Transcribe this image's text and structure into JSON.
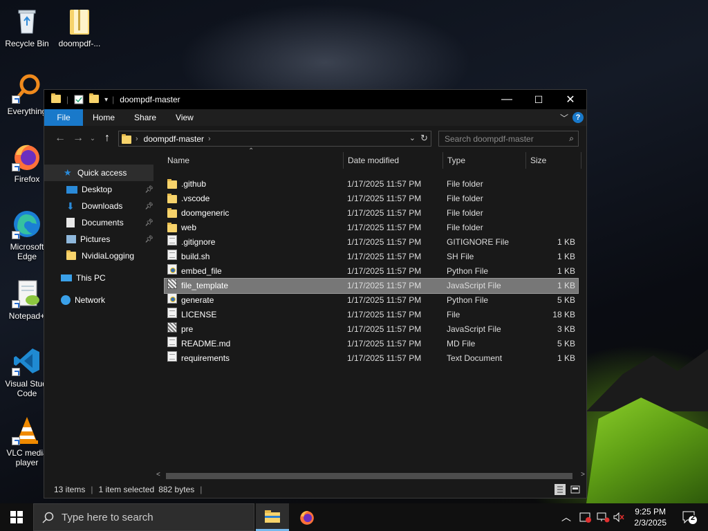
{
  "desktop": {
    "icons": [
      {
        "label": "Recycle Bin"
      },
      {
        "label": "doompdf-..."
      },
      {
        "label": "Everything"
      },
      {
        "label": "Firefox"
      },
      {
        "label": "Microsoft\nEdge"
      },
      {
        "label": "Notepad+"
      },
      {
        "label": "Visual Studi\nCode"
      },
      {
        "label": "VLC media\nplayer"
      }
    ]
  },
  "window": {
    "title": "doompdf-master",
    "controls": {
      "minimize": "—",
      "maximize": "☐",
      "close": "✕"
    },
    "ribbon": {
      "tabs": [
        "File",
        "Home",
        "Share",
        "View"
      ],
      "help": "?"
    },
    "address": {
      "crumb": "doompdf-master",
      "search_placeholder": "Search doompdf-master"
    },
    "nav": {
      "quick_access": "Quick access",
      "items": [
        "Desktop",
        "Downloads",
        "Documents",
        "Pictures",
        "NvidiaLogging"
      ],
      "this_pc": "This PC",
      "network": "Network"
    },
    "columns": {
      "name": "Name",
      "date": "Date modified",
      "type": "Type",
      "size": "Size"
    },
    "files": [
      {
        "name": ".github",
        "date": "1/17/2025 11:57 PM",
        "type": "File folder",
        "size": "",
        "icon": "folder-icon"
      },
      {
        "name": ".vscode",
        "date": "1/17/2025 11:57 PM",
        "type": "File folder",
        "size": "",
        "icon": "folder-icon"
      },
      {
        "name": "doomgeneric",
        "date": "1/17/2025 11:57 PM",
        "type": "File folder",
        "size": "",
        "icon": "folder-icon"
      },
      {
        "name": "web",
        "date": "1/17/2025 11:57 PM",
        "type": "File folder",
        "size": "",
        "icon": "folder-icon"
      },
      {
        "name": ".gitignore",
        "date": "1/17/2025 11:57 PM",
        "type": "GITIGNORE File",
        "size": "1 KB",
        "icon": "document-icon"
      },
      {
        "name": "build.sh",
        "date": "1/17/2025 11:57 PM",
        "type": "SH File",
        "size": "1 KB",
        "icon": "document-icon"
      },
      {
        "name": "embed_file",
        "date": "1/17/2025 11:57 PM",
        "type": "Python File",
        "size": "1 KB",
        "icon": "python-file-icon"
      },
      {
        "name": "file_template",
        "date": "1/17/2025 11:57 PM",
        "type": "JavaScript File",
        "size": "1 KB",
        "icon": "javascript-file-icon",
        "selected": true
      },
      {
        "name": "generate",
        "date": "1/17/2025 11:57 PM",
        "type": "Python File",
        "size": "5 KB",
        "icon": "python-file-icon"
      },
      {
        "name": "LICENSE",
        "date": "1/17/2025 11:57 PM",
        "type": "File",
        "size": "18 KB",
        "icon": "document-icon"
      },
      {
        "name": "pre",
        "date": "1/17/2025 11:57 PM",
        "type": "JavaScript File",
        "size": "3 KB",
        "icon": "javascript-file-icon"
      },
      {
        "name": "README.md",
        "date": "1/17/2025 11:57 PM",
        "type": "MD File",
        "size": "5 KB",
        "icon": "document-icon"
      },
      {
        "name": "requirements",
        "date": "1/17/2025 11:57 PM",
        "type": "Text Document",
        "size": "1 KB",
        "icon": "document-icon"
      }
    ],
    "status": {
      "count": "13 items",
      "selection": "1 item selected",
      "size": "882 bytes"
    }
  },
  "taskbar": {
    "search_placeholder": "Type here to search",
    "time": "9:25 PM",
    "date": "2/3/2025",
    "notification_count": "2"
  },
  "colors": {
    "accent": "#1979ca",
    "window_bg": "#191919",
    "selection": "#777777",
    "folder": "#f7d36b"
  }
}
